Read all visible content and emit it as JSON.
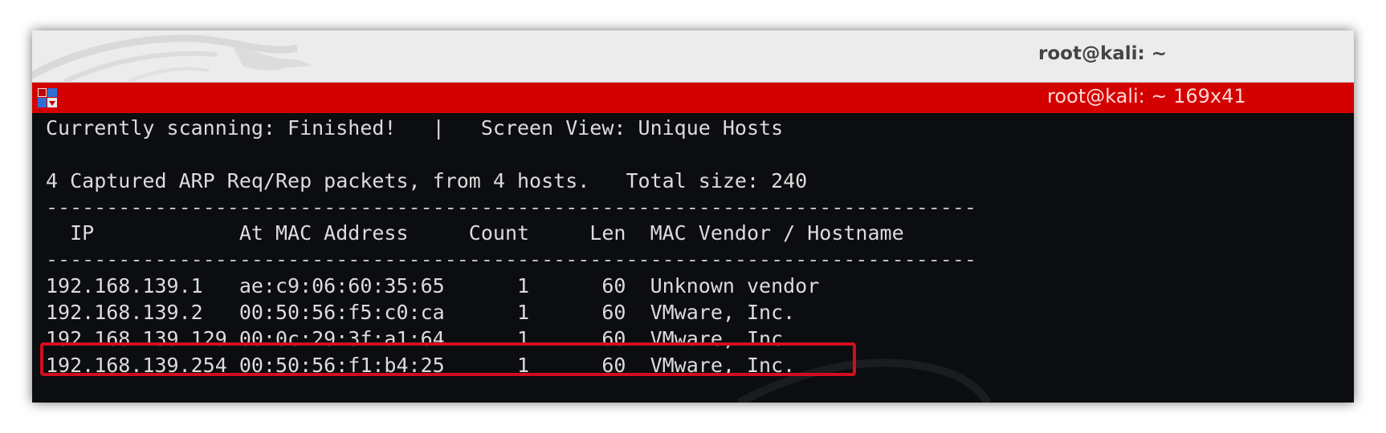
{
  "window": {
    "title": "root@kali: ~",
    "tab_title": "root@kali: ~ 169x41"
  },
  "terminal": {
    "status_line": "Currently scanning: Finished!   |   Screen View: Unique Hosts",
    "summary_line": "4 Captured ARP Req/Rep packets, from 4 hosts.   Total size: 240",
    "separator": "-----------------------------------------------------------------------------",
    "header": "  IP            At MAC Address     Count     Len  MAC Vendor / Hostname",
    "rows": [
      "192.168.139.1   ae:c9:06:60:35:65      1      60  Unknown vendor",
      "192.168.139.2   00:50:56:f5:c0:ca      1      60  VMware, Inc.",
      "192.168.139.129 00:0c:29:3f:a1:64      1      60  VMware, Inc.",
      "192.168.139.254 00:50:56:f1:b4:25      1      60  VMware, Inc."
    ],
    "highlighted_row": 2
  },
  "colors": {
    "tab_bar": "#d40000",
    "terminal_bg": "#0b0d10",
    "highlight_box": "#d10d1d"
  },
  "icons": {
    "titlebar_logo": "kali-dragon-icon",
    "tab_icon": "terminal-icon"
  }
}
